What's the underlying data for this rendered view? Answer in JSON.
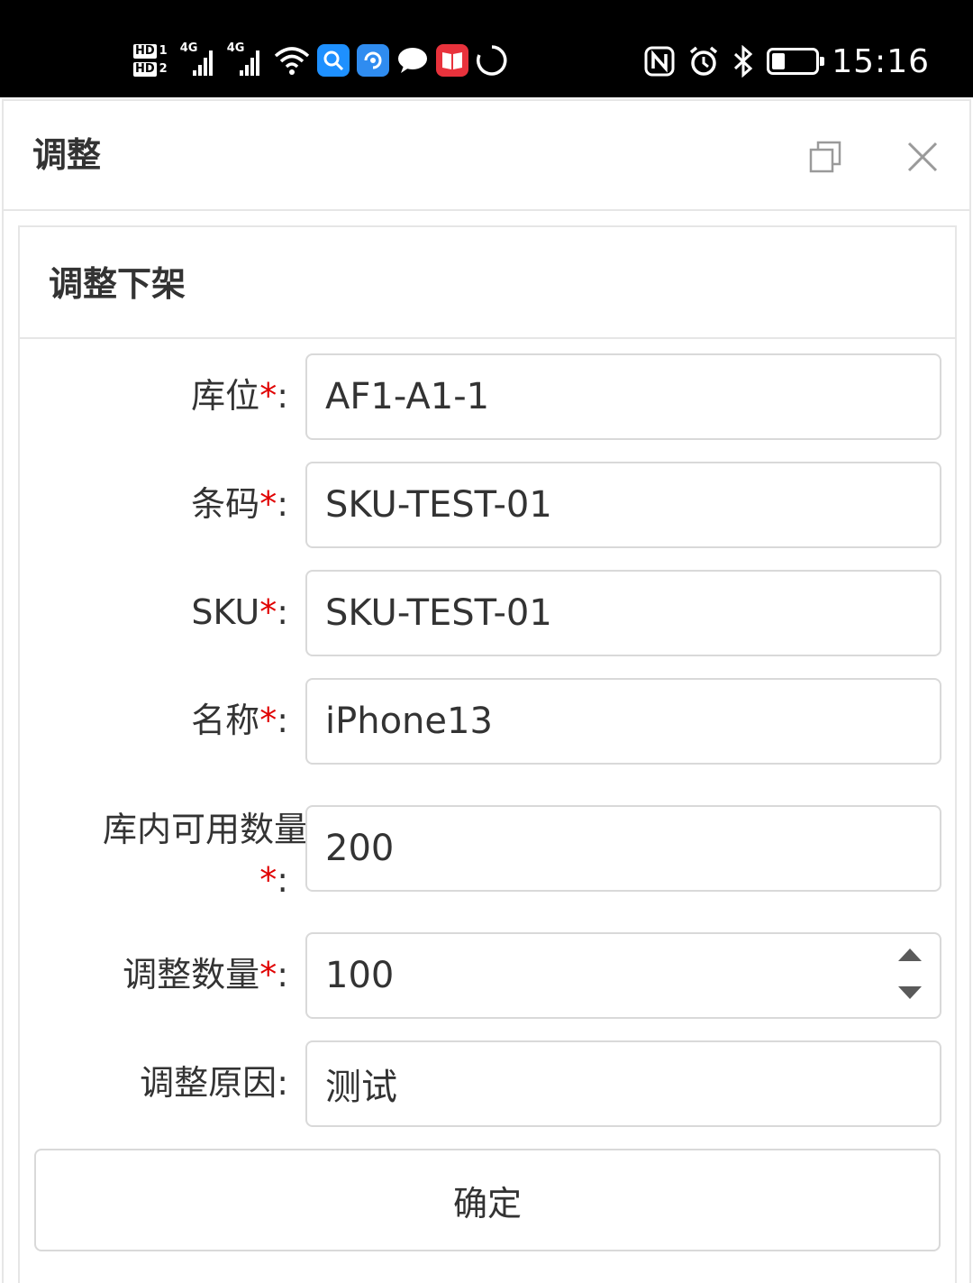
{
  "status_bar": {
    "sim1": "HD",
    "sim1_num": "1",
    "sim2": "HD",
    "sim2_num": "2",
    "net1": "4G",
    "net2": "4G",
    "time": "15:16",
    "icons": [
      "signal-icon",
      "signal-icon",
      "wifi-icon",
      "search-app-icon",
      "assistant-app-icon",
      "message-app-icon",
      "book-app-icon",
      "loading-icon",
      "nfc-icon",
      "alarm-icon",
      "bluetooth-icon",
      "battery-icon"
    ]
  },
  "dialog": {
    "title": "调整"
  },
  "panel": {
    "title": "调整下架"
  },
  "form": {
    "location": {
      "label": "库位",
      "required": "*",
      "colon": ":",
      "value": "AF1-A1-1"
    },
    "barcode": {
      "label": "条码",
      "required": "*",
      "colon": ":",
      "value": "SKU-TEST-01"
    },
    "sku": {
      "label": "SKU",
      "required": "*",
      "colon": ":",
      "value": "SKU-TEST-01"
    },
    "name": {
      "label": "名称",
      "required": "*",
      "colon": ":",
      "value": "iPhone13"
    },
    "available_qty": {
      "label": "库内可用数量",
      "required": "*",
      "colon": ":",
      "value": "200"
    },
    "adjust_qty": {
      "label": "调整数量",
      "required": "*",
      "colon": ":",
      "value": "100"
    },
    "reason": {
      "label": "调整原因",
      "colon": ":",
      "value": "测试"
    },
    "submit_label": "确定"
  },
  "colors": {
    "required": "#e00000",
    "border": "#d9d9d9",
    "text": "#333333",
    "app_search": "#1e90ff",
    "app_assistant": "#2f8cf0",
    "app_book": "#e8323c"
  }
}
